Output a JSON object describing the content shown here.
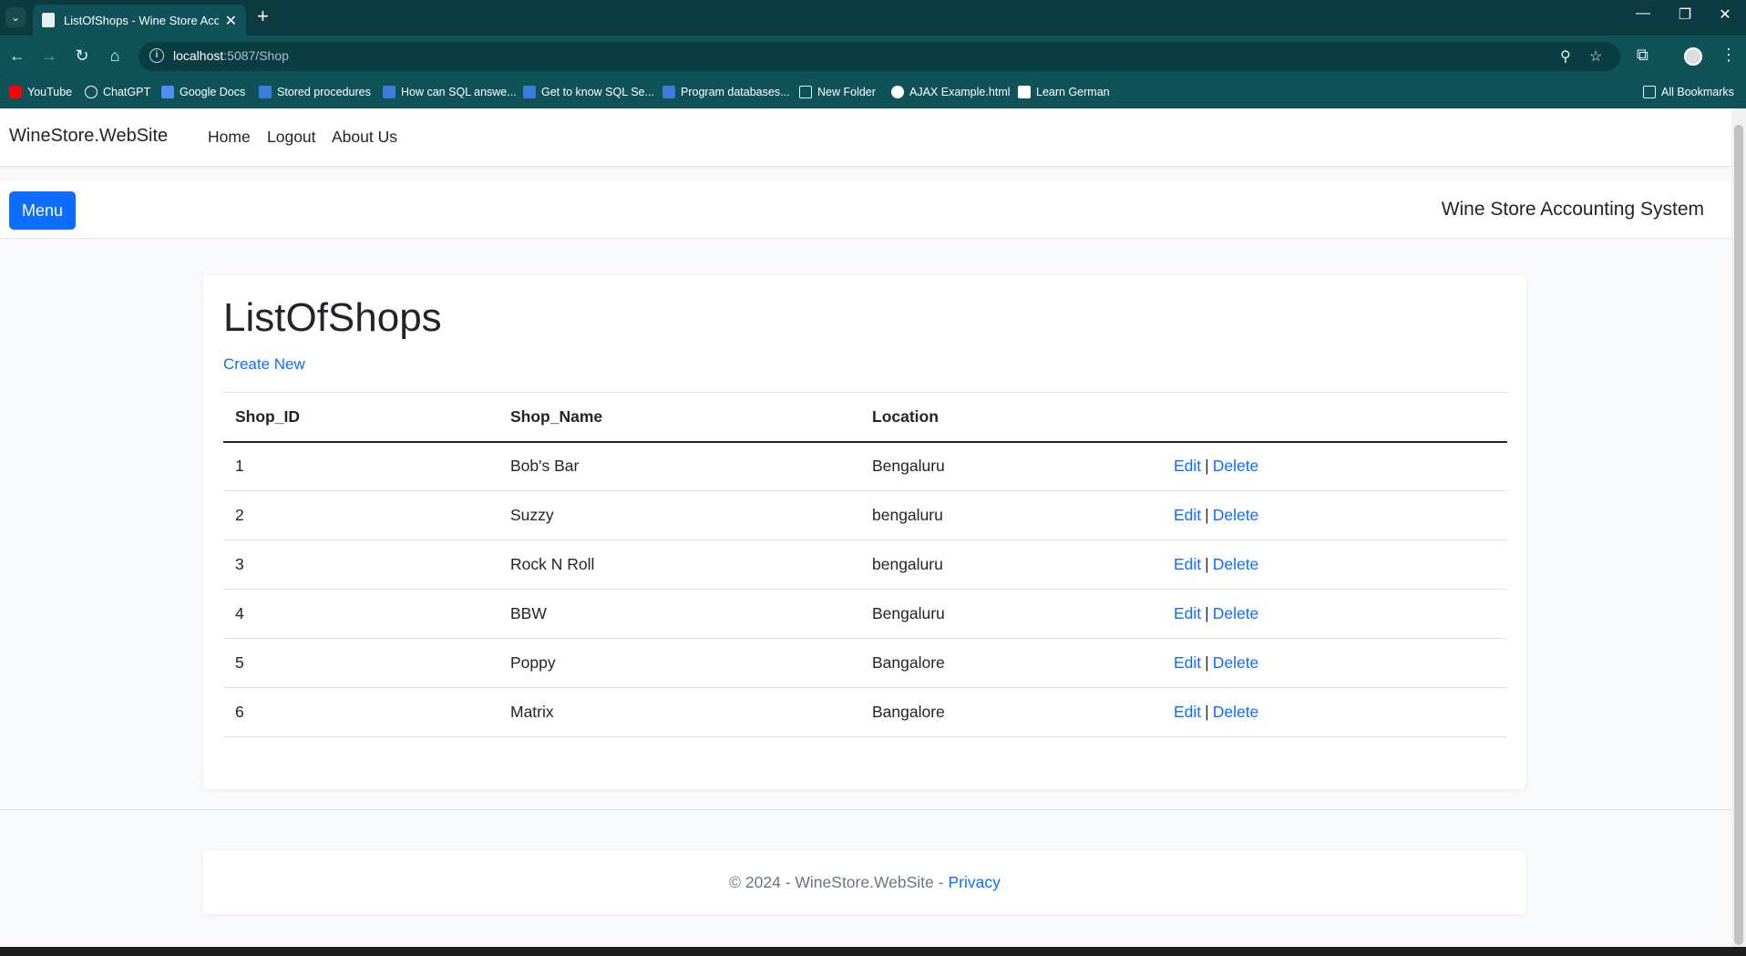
{
  "browser": {
    "tab_title": "ListOfShops - Wine Store Accounting",
    "url_host": "localhost",
    "url_path": ":5087/Shop",
    "window_controls": [
      "—",
      "❐",
      "✕"
    ],
    "bookmarks": [
      {
        "label": "YouTube",
        "icon": "youtube-icon"
      },
      {
        "label": "ChatGPT",
        "icon": "chatgpt-icon"
      },
      {
        "label": "Google Docs",
        "icon": "docs-icon"
      },
      {
        "label": "Stored procedures",
        "icon": "video-icon"
      },
      {
        "label": "How can SQL answe...",
        "icon": "video-icon"
      },
      {
        "label": "Get to know SQL Se...",
        "icon": "video-icon"
      },
      {
        "label": "Program databases...",
        "icon": "video-icon"
      },
      {
        "label": "New Folder",
        "icon": "folder-icon"
      },
      {
        "label": "AJAX Example.html",
        "icon": "globe-icon"
      },
      {
        "label": "Learn German",
        "icon": "learn-icon"
      }
    ],
    "all_bookmarks": "All Bookmarks"
  },
  "site": {
    "brand": "WineStore.WebSite",
    "nav": [
      "Home",
      "Logout",
      "About Us"
    ],
    "menu_button": "Menu",
    "system_title": "Wine Store Accounting System"
  },
  "main": {
    "heading": "ListOfShops",
    "create_link": "Create New",
    "columns": [
      "Shop_ID",
      "Shop_Name",
      "Location"
    ],
    "rows": [
      {
        "id": "1",
        "name": "Bob's Bar",
        "location": "Bengaluru"
      },
      {
        "id": "2",
        "name": "Suzzy",
        "location": "bengaluru"
      },
      {
        "id": "3",
        "name": "Rock N Roll",
        "location": "bengaluru"
      },
      {
        "id": "4",
        "name": "BBW",
        "location": "Bengaluru"
      },
      {
        "id": "5",
        "name": "Poppy",
        "location": "Bangalore"
      },
      {
        "id": "6",
        "name": "Matrix",
        "location": "Bangalore"
      }
    ],
    "edit_label": "Edit",
    "delete_label": "Delete",
    "action_separator": "|"
  },
  "footer": {
    "text": "© 2024 - WineStore.WebSite -",
    "privacy": "Privacy"
  }
}
